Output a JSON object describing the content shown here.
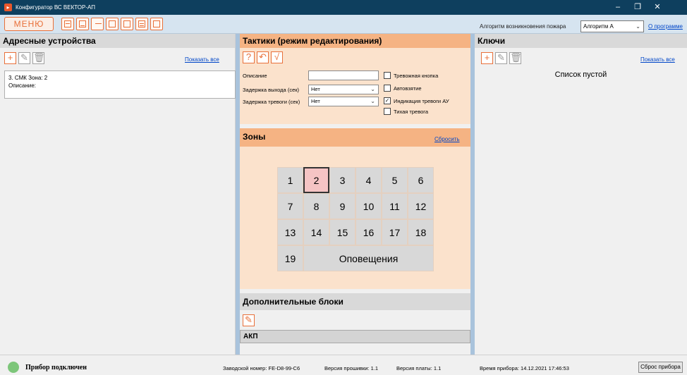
{
  "window": {
    "title": "Конфигуратор ВС ВЕКТОР-АП",
    "minimize": "–",
    "maximize": "❐",
    "close": "✕"
  },
  "toolbar": {
    "menu_label": "МЕНЮ",
    "algorithm_label": "Алгоритм возникновения пожара",
    "algorithm_value": "Алгоритм А",
    "about_link": "О программе"
  },
  "address_devices": {
    "title": "Адресные устройства",
    "show_all": "Показать все",
    "device_line1": "3.  СМК  Зона: 2",
    "device_line2": "Описание:"
  },
  "tactics": {
    "title": "Тактики (режим редактирования)",
    "help_btn": "?",
    "undo_btn": "↶",
    "apply_btn": "√",
    "description_label": "Описание",
    "description_value": "",
    "exit_delay_label": "Задержка выхода (сек)",
    "exit_delay_value": "Нет",
    "alarm_delay_label": "Задержка тревоги (сек)",
    "alarm_delay_value": "Нет",
    "checkboxes": [
      {
        "label": "Тревожная кнопка",
        "checked": false
      },
      {
        "label": "Автовзятие",
        "checked": false
      },
      {
        "label": "Индикация тревоги АУ",
        "checked": true
      },
      {
        "label": "Тихая тревога",
        "checked": false
      }
    ]
  },
  "zones": {
    "title": "Зоны",
    "reset_link": "Сбросить",
    "cells": [
      "1",
      "2",
      "3",
      "4",
      "5",
      "6",
      "7",
      "8",
      "9",
      "10",
      "11",
      "12",
      "13",
      "14",
      "15",
      "16",
      "17",
      "18",
      "19"
    ],
    "active": "2",
    "notifications": "Оповещения"
  },
  "extra_blocks": {
    "title": "Дополнительные блоки",
    "row": "АКП"
  },
  "keys": {
    "title": "Ключи",
    "show_all": "Показать все",
    "empty": "Список пустой"
  },
  "status": {
    "connected": "Прибор подключен",
    "serial": "Заводской номер: FE-D8-99-C6",
    "firmware": "Версия прошивки: 1.1",
    "board": "Версия платы: 1.1",
    "device_time": "Время прибора: 14.12.2021 17:46:53",
    "reset_btn": "Сброс прибора"
  },
  "colors": {
    "accent": "#e8703a",
    "panel_header": "#f5b383",
    "panel_bg": "#fbe2cc",
    "titlebar": "#0e3f5e",
    "status_ok": "#7dc67a"
  }
}
